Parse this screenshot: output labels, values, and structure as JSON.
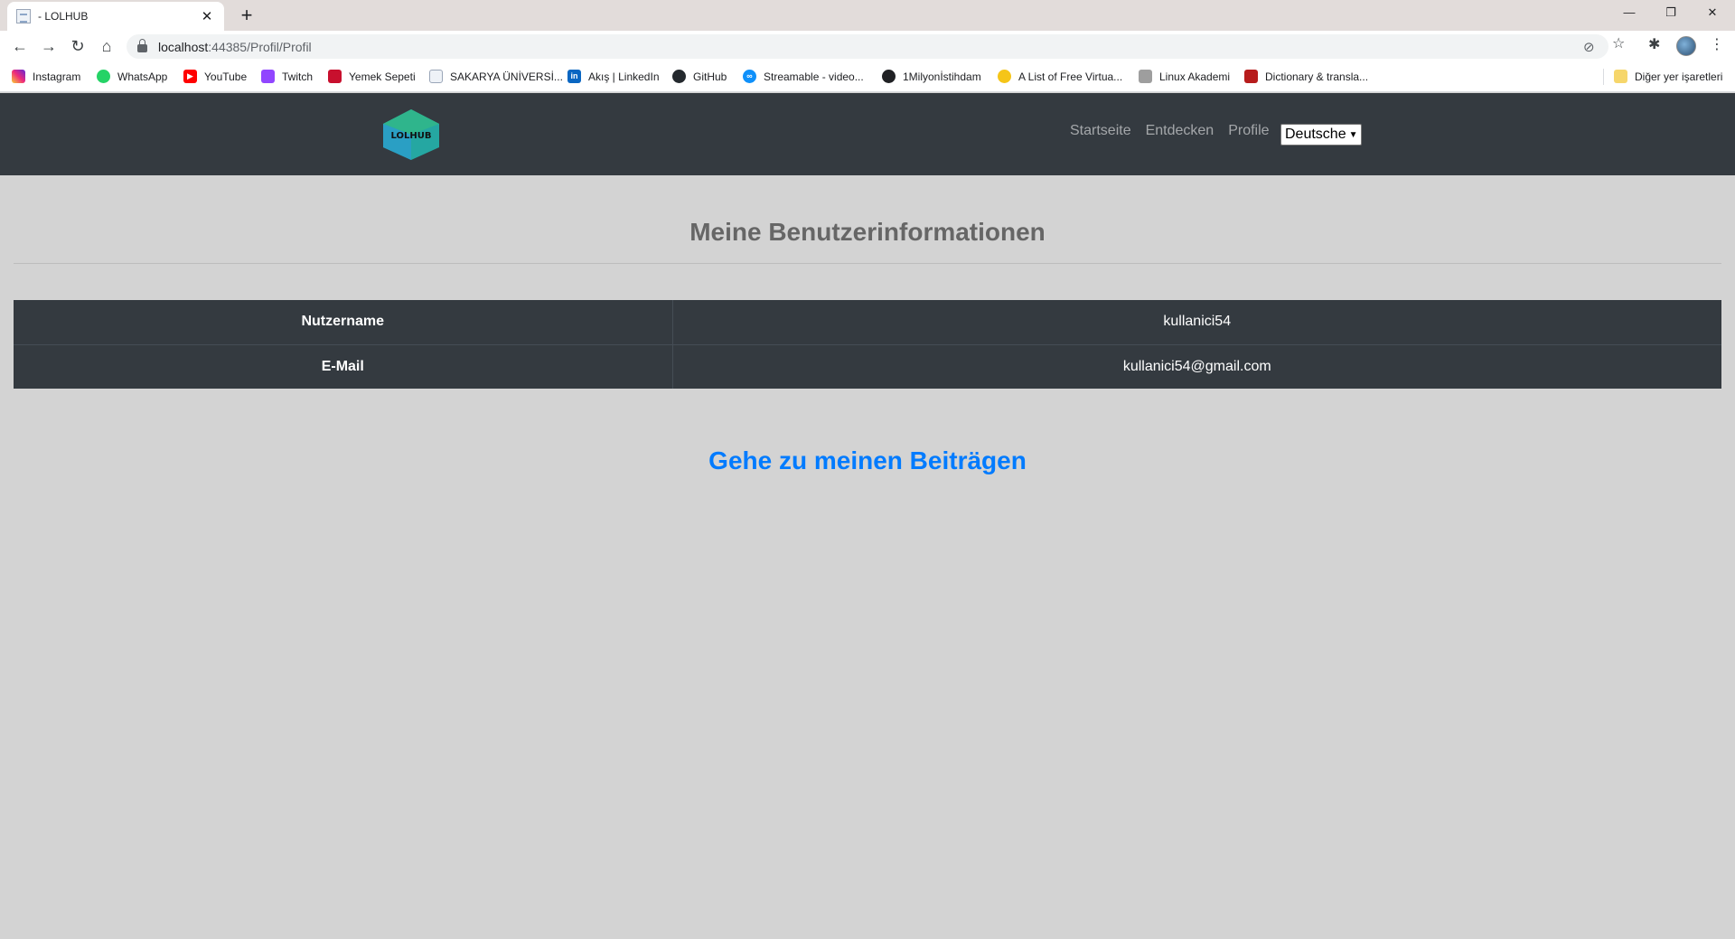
{
  "browser": {
    "tab_title": "- LOLHUB",
    "url_host": "localhost",
    "url_path": ":44385/Profil/Profil",
    "bookmarks": [
      {
        "label": "Instagram",
        "icon": "instagram-icon",
        "color": "#d62976"
      },
      {
        "label": "WhatsApp",
        "icon": "whatsapp-icon",
        "color": "#25d366"
      },
      {
        "label": "YouTube",
        "icon": "youtube-icon",
        "color": "#ff0000"
      },
      {
        "label": "Twitch",
        "icon": "twitch-icon",
        "color": "#9146ff"
      },
      {
        "label": "Yemek Sepeti",
        "icon": "yemeksepeti-icon",
        "color": "#c8102e"
      },
      {
        "label": "SAKARYA ÜNİVERSİ...",
        "icon": "page-icon",
        "color": "#8ea7c8"
      },
      {
        "label": "Akış | LinkedIn",
        "icon": "linkedin-icon",
        "color": "#0a66c2"
      },
      {
        "label": "GitHub",
        "icon": "github-icon",
        "color": "#24292e"
      },
      {
        "label": "Streamable - video...",
        "icon": "streamable-icon",
        "color": "#0f90fa"
      },
      {
        "label": "1Milyonİstihdam",
        "icon": "globe-icon",
        "color": "#202124"
      },
      {
        "label": "A List of Free Virtua...",
        "icon": "emoji-icon",
        "color": "#f5c518"
      },
      {
        "label": "Linux Akademi",
        "icon": "linux-icon",
        "color": "#6b6b6b"
      },
      {
        "label": "Dictionary & transla...",
        "icon": "dictionary-icon",
        "color": "#b71c1c"
      }
    ],
    "other_bookmarks": "Diğer yer işaretleri"
  },
  "navbar": {
    "logo_text": "LOLHUB",
    "links": [
      "Startseite",
      "Entdecken",
      "Profile"
    ],
    "language": "Deutsche"
  },
  "main": {
    "title": "Meine Benutzerinformationen",
    "rows": [
      {
        "key": "Nutzername",
        "value": "kullanici54"
      },
      {
        "key": "E-Mail",
        "value": "kullanici54@gmail.com"
      }
    ],
    "posts_link": "Gehe zu meinen Beiträgen"
  },
  "colors": {
    "navbar_bg": "#343a40",
    "page_bg": "#d3d3d3",
    "link_blue": "#007bff",
    "logo_teal": "#2cb5a0"
  }
}
